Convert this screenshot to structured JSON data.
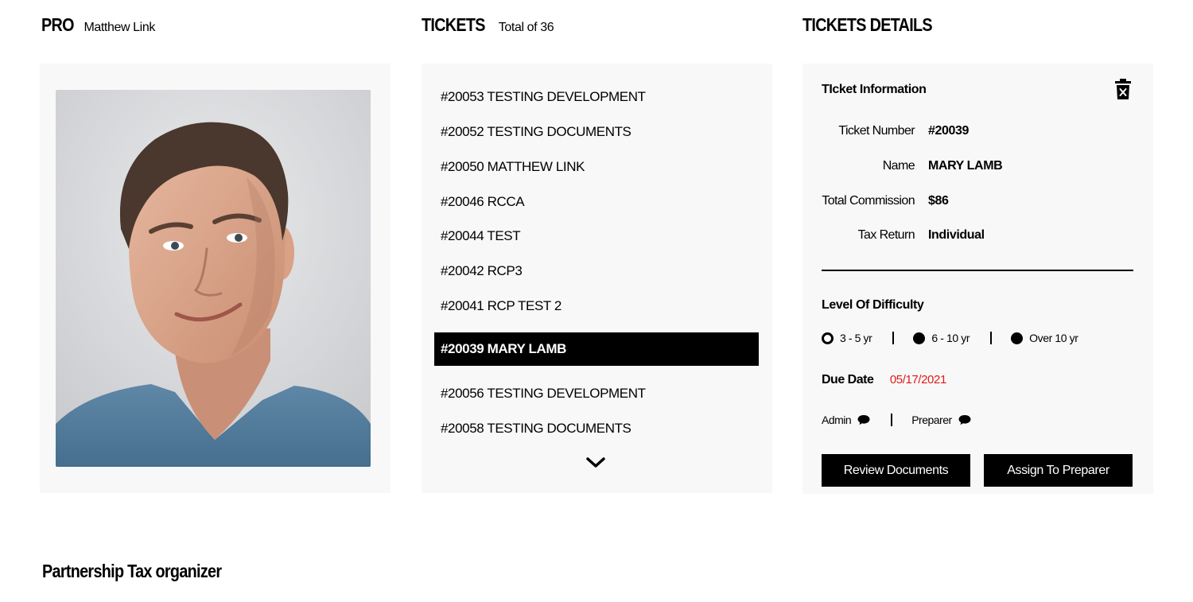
{
  "pro": {
    "heading": "PRO",
    "name": "Matthew Link"
  },
  "tickets": {
    "heading": "TICKETS",
    "total_label": "Total of 36",
    "items": [
      {
        "label": "#20053 TESTING DEVELOPMENT",
        "selected": false
      },
      {
        "label": "#20052 TESTING DOCUMENTS",
        "selected": false
      },
      {
        "label": "#20050 MATTHEW LINK",
        "selected": false
      },
      {
        "label": "#20046 RCCA",
        "selected": false
      },
      {
        "label": "#20044 TEST",
        "selected": false
      },
      {
        "label": "#20042 RCP3",
        "selected": false
      },
      {
        "label": "#20041 RCP TEST 2",
        "selected": false
      },
      {
        "label": "#20039 MARY LAMB",
        "selected": true
      },
      {
        "label": "#20056 TESTING DEVELOPMENT",
        "selected": false
      },
      {
        "label": "#20058 TESTING DOCUMENTS",
        "selected": false
      }
    ],
    "more_icon": "chevron-down-icon"
  },
  "details": {
    "heading": "TICKETS DETAILS",
    "section_title": "TIcket Information",
    "delete_icon": "trash-icon",
    "fields": [
      {
        "label": "Ticket Number",
        "value": "#20039"
      },
      {
        "label": "Name",
        "value": "MARY LAMB"
      },
      {
        "label": "Total Commission",
        "value": "$86"
      },
      {
        "label": "Tax Return",
        "value": "Individual"
      }
    ],
    "difficulty": {
      "label": "Level Of Difficulty",
      "options": [
        {
          "label": "3 - 5 yr",
          "selected": true
        },
        {
          "label": "6 - 10 yr",
          "selected": false
        },
        {
          "label": "Over 10 yr",
          "selected": false
        }
      ]
    },
    "due_date": {
      "label": "Due Date",
      "value": "05/17/2021",
      "color": "#e01b1b"
    },
    "comments": [
      {
        "label": "Admin",
        "icon": "chat-bubble-icon"
      },
      {
        "label": "Preparer",
        "icon": "chat-bubble-icon"
      }
    ],
    "buttons": {
      "review": "Review Documents",
      "assign": "Assign To Preparer"
    }
  },
  "bottom": {
    "title": "Partnership Tax organizer"
  }
}
